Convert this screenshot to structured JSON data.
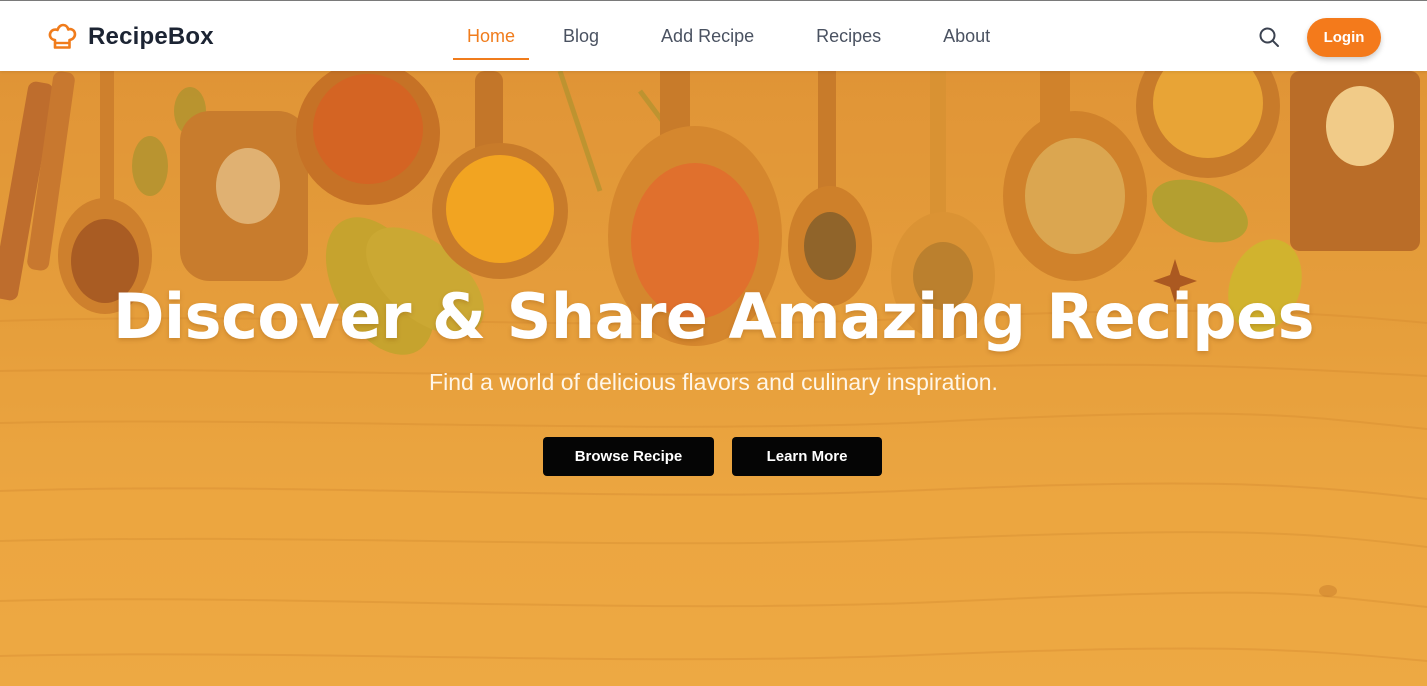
{
  "brand": {
    "name": "RecipeBox",
    "icon": "chef-hat-icon",
    "color": "#f07c1c"
  },
  "nav": {
    "items": [
      {
        "label": "Home",
        "active": true
      },
      {
        "label": "Blog",
        "active": false
      },
      {
        "label": "Add Recipe",
        "active": false
      },
      {
        "label": "Recipes",
        "active": false
      },
      {
        "label": "About",
        "active": false
      }
    ],
    "search_icon": "search-icon",
    "login_label": "Login"
  },
  "hero": {
    "title": "Discover & Share Amazing Recipes",
    "subtitle": "Find a world of delicious flavors and culinary inspiration.",
    "browse_label": "Browse Recipe",
    "learn_label": "Learn More",
    "background": "wooden table with spices in spoons and bowls, orange overlay"
  },
  "colors": {
    "accent": "#f07c1c",
    "login_bg": "#f47a1b",
    "hero_overlay": "#e9a545",
    "button_dark": "#050505"
  }
}
